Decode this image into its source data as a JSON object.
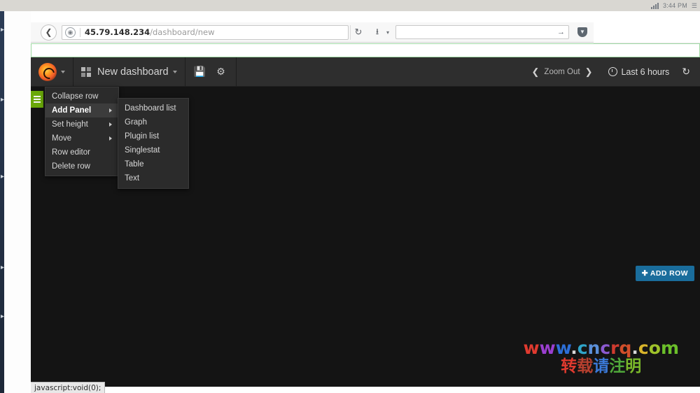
{
  "taskbar": {
    "clock": "3:44 PM",
    "volume_icon": "volume-icon",
    "signal_icon": "signal-bars-icon",
    "tray_icon": "tray-icon"
  },
  "browser": {
    "back_icon": "back-arrow-icon",
    "site_identity_icon": "globe-icon",
    "url_host": "45.79.148.234",
    "url_path": "/dashboard/new",
    "url_full": "45.79.148.234/dashboard/new",
    "reload_icon": "reload-icon",
    "download_icon": "download-icon",
    "download_caret_icon": "chevron-down-icon",
    "search_value": "",
    "search_placeholder": "",
    "search_go_icon": "arrow-right-icon",
    "shield_icon": "shield-icon"
  },
  "grafana": {
    "logo_icon": "grafana-logo-icon",
    "logo_caret_icon": "chevron-down-icon",
    "dashboard_grid_icon": "dashboard-grid-icon",
    "dashboard_title": "New dashboard",
    "dashboard_caret_icon": "chevron-down-icon",
    "save_icon": "save-floppy-icon",
    "settings_icon": "gear-icon",
    "zoom_out_label": "Zoom Out",
    "zoom_prev_icon": "chevron-left-icon",
    "zoom_next_icon": "chevron-right-icon",
    "time_range_label": "Last 6 hours",
    "clock_icon": "clock-icon",
    "refresh_icon": "refresh-icon",
    "row_handle_icon": "row-menu-hamburger-icon",
    "add_row_label": "ADD ROW",
    "add_row_plus_icon": "plus-icon",
    "accent_color": "#1a6d9c",
    "row_handle_color": "#6aa80a",
    "background_color": "#141414"
  },
  "row_menu": {
    "items": [
      {
        "label": "Collapse row",
        "has_submenu": false,
        "active": false
      },
      {
        "label": "Add Panel",
        "has_submenu": true,
        "active": true
      },
      {
        "label": "Set height",
        "has_submenu": true,
        "active": false
      },
      {
        "label": "Move",
        "has_submenu": true,
        "active": false
      },
      {
        "label": "Row editor",
        "has_submenu": false,
        "active": false
      },
      {
        "label": "Delete row",
        "has_submenu": false,
        "active": false
      }
    ]
  },
  "add_panel_submenu": {
    "items": [
      {
        "label": "Dashboard list"
      },
      {
        "label": "Graph"
      },
      {
        "label": "Plugin list"
      },
      {
        "label": "Singlestat"
      },
      {
        "label": "Table"
      },
      {
        "label": "Text"
      }
    ]
  },
  "watermark": {
    "url": "www.cncrq.com",
    "subtitle": "转载请注明",
    "url_letters": [
      {
        "c": "w",
        "color": "#e03a2f"
      },
      {
        "c": "w",
        "color": "#9b3fd0"
      },
      {
        "c": "w",
        "color": "#2d6fd8"
      },
      {
        "c": ".",
        "color": "#d8d8d8"
      },
      {
        "c": "c",
        "color": "#2fa5c9"
      },
      {
        "c": "n",
        "color": "#5a8fd8"
      },
      {
        "c": "c",
        "color": "#8b5ad0"
      },
      {
        "c": "r",
        "color": "#cf3b2f"
      },
      {
        "c": "q",
        "color": "#d14e2a"
      },
      {
        "c": ".",
        "color": "#d8d8d8"
      },
      {
        "c": "c",
        "color": "#d8b42a"
      },
      {
        "c": "o",
        "color": "#9fc22a"
      },
      {
        "c": "m",
        "color": "#6bbf2a"
      }
    ],
    "subtitle_letters": [
      {
        "c": "转",
        "color": "#e03a2f"
      },
      {
        "c": "载",
        "color": "#b8402f"
      },
      {
        "c": "请",
        "color": "#3b79d8"
      },
      {
        "c": "注",
        "color": "#4fa83a"
      },
      {
        "c": "明",
        "color": "#7ab82a"
      }
    ]
  },
  "status_bar": {
    "text": "javascript:void(0);"
  }
}
